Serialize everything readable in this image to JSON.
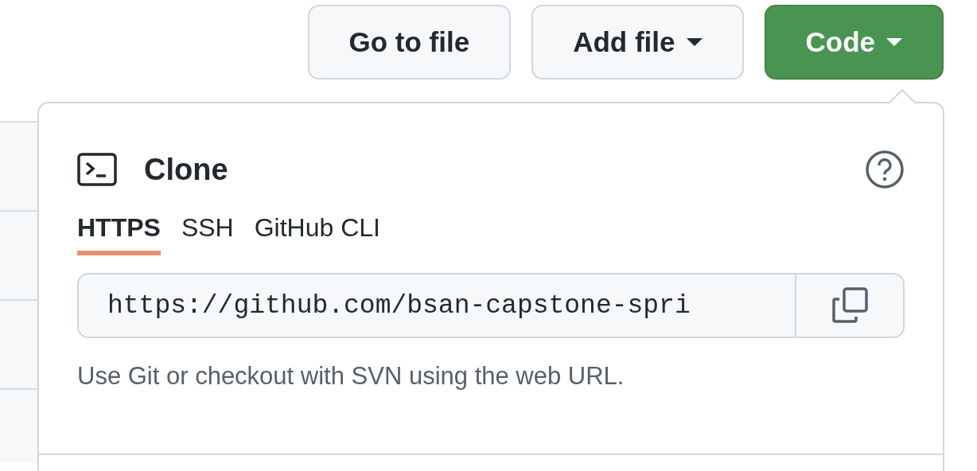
{
  "toolbar": {
    "buttons": [
      {
        "label": "Go to file",
        "kind": "plain",
        "caret": false
      },
      {
        "label": "Add file",
        "kind": "plain",
        "caret": true
      },
      {
        "label": "Code",
        "kind": "primary",
        "caret": true
      }
    ]
  },
  "clone_panel": {
    "title": "Clone",
    "tabs": [
      {
        "label": "HTTPS",
        "selected": true
      },
      {
        "label": "SSH",
        "selected": false
      },
      {
        "label": "GitHub CLI",
        "selected": false
      }
    ],
    "url_field": {
      "value": "https://github.com/bsan-capstone-spri"
    },
    "hint": "Use Git or checkout with SVN using the web URL."
  }
}
